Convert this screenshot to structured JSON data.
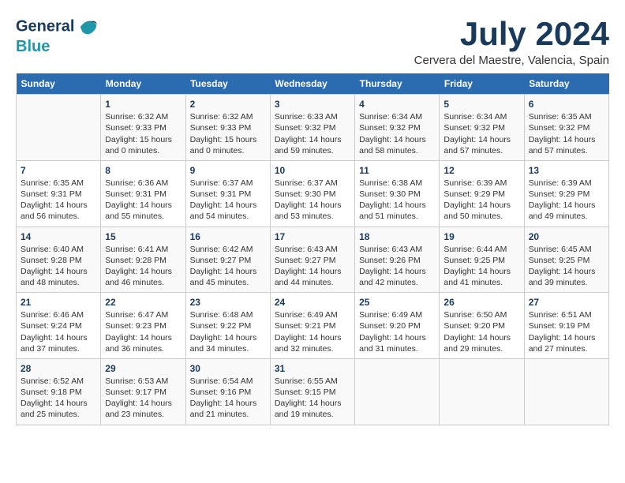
{
  "header": {
    "logo_line1": "General",
    "logo_line2": "Blue",
    "month_year": "July 2024",
    "location": "Cervera del Maestre, Valencia, Spain"
  },
  "days_of_week": [
    "Sunday",
    "Monday",
    "Tuesday",
    "Wednesday",
    "Thursday",
    "Friday",
    "Saturday"
  ],
  "weeks": [
    [
      {
        "day": "",
        "info": ""
      },
      {
        "day": "1",
        "info": "Sunrise: 6:32 AM\nSunset: 9:33 PM\nDaylight: 15 hours\nand 0 minutes."
      },
      {
        "day": "2",
        "info": "Sunrise: 6:32 AM\nSunset: 9:33 PM\nDaylight: 15 hours\nand 0 minutes."
      },
      {
        "day": "3",
        "info": "Sunrise: 6:33 AM\nSunset: 9:32 PM\nDaylight: 14 hours\nand 59 minutes."
      },
      {
        "day": "4",
        "info": "Sunrise: 6:34 AM\nSunset: 9:32 PM\nDaylight: 14 hours\nand 58 minutes."
      },
      {
        "day": "5",
        "info": "Sunrise: 6:34 AM\nSunset: 9:32 PM\nDaylight: 14 hours\nand 57 minutes."
      },
      {
        "day": "6",
        "info": "Sunrise: 6:35 AM\nSunset: 9:32 PM\nDaylight: 14 hours\nand 57 minutes."
      }
    ],
    [
      {
        "day": "7",
        "info": "Sunrise: 6:35 AM\nSunset: 9:31 PM\nDaylight: 14 hours\nand 56 minutes."
      },
      {
        "day": "8",
        "info": "Sunrise: 6:36 AM\nSunset: 9:31 PM\nDaylight: 14 hours\nand 55 minutes."
      },
      {
        "day": "9",
        "info": "Sunrise: 6:37 AM\nSunset: 9:31 PM\nDaylight: 14 hours\nand 54 minutes."
      },
      {
        "day": "10",
        "info": "Sunrise: 6:37 AM\nSunset: 9:30 PM\nDaylight: 14 hours\nand 53 minutes."
      },
      {
        "day": "11",
        "info": "Sunrise: 6:38 AM\nSunset: 9:30 PM\nDaylight: 14 hours\nand 51 minutes."
      },
      {
        "day": "12",
        "info": "Sunrise: 6:39 AM\nSunset: 9:29 PM\nDaylight: 14 hours\nand 50 minutes."
      },
      {
        "day": "13",
        "info": "Sunrise: 6:39 AM\nSunset: 9:29 PM\nDaylight: 14 hours\nand 49 minutes."
      }
    ],
    [
      {
        "day": "14",
        "info": "Sunrise: 6:40 AM\nSunset: 9:28 PM\nDaylight: 14 hours\nand 48 minutes."
      },
      {
        "day": "15",
        "info": "Sunrise: 6:41 AM\nSunset: 9:28 PM\nDaylight: 14 hours\nand 46 minutes."
      },
      {
        "day": "16",
        "info": "Sunrise: 6:42 AM\nSunset: 9:27 PM\nDaylight: 14 hours\nand 45 minutes."
      },
      {
        "day": "17",
        "info": "Sunrise: 6:43 AM\nSunset: 9:27 PM\nDaylight: 14 hours\nand 44 minutes."
      },
      {
        "day": "18",
        "info": "Sunrise: 6:43 AM\nSunset: 9:26 PM\nDaylight: 14 hours\nand 42 minutes."
      },
      {
        "day": "19",
        "info": "Sunrise: 6:44 AM\nSunset: 9:25 PM\nDaylight: 14 hours\nand 41 minutes."
      },
      {
        "day": "20",
        "info": "Sunrise: 6:45 AM\nSunset: 9:25 PM\nDaylight: 14 hours\nand 39 minutes."
      }
    ],
    [
      {
        "day": "21",
        "info": "Sunrise: 6:46 AM\nSunset: 9:24 PM\nDaylight: 14 hours\nand 37 minutes."
      },
      {
        "day": "22",
        "info": "Sunrise: 6:47 AM\nSunset: 9:23 PM\nDaylight: 14 hours\nand 36 minutes."
      },
      {
        "day": "23",
        "info": "Sunrise: 6:48 AM\nSunset: 9:22 PM\nDaylight: 14 hours\nand 34 minutes."
      },
      {
        "day": "24",
        "info": "Sunrise: 6:49 AM\nSunset: 9:21 PM\nDaylight: 14 hours\nand 32 minutes."
      },
      {
        "day": "25",
        "info": "Sunrise: 6:49 AM\nSunset: 9:20 PM\nDaylight: 14 hours\nand 31 minutes."
      },
      {
        "day": "26",
        "info": "Sunrise: 6:50 AM\nSunset: 9:20 PM\nDaylight: 14 hours\nand 29 minutes."
      },
      {
        "day": "27",
        "info": "Sunrise: 6:51 AM\nSunset: 9:19 PM\nDaylight: 14 hours\nand 27 minutes."
      }
    ],
    [
      {
        "day": "28",
        "info": "Sunrise: 6:52 AM\nSunset: 9:18 PM\nDaylight: 14 hours\nand 25 minutes."
      },
      {
        "day": "29",
        "info": "Sunrise: 6:53 AM\nSunset: 9:17 PM\nDaylight: 14 hours\nand 23 minutes."
      },
      {
        "day": "30",
        "info": "Sunrise: 6:54 AM\nSunset: 9:16 PM\nDaylight: 14 hours\nand 21 minutes."
      },
      {
        "day": "31",
        "info": "Sunrise: 6:55 AM\nSunset: 9:15 PM\nDaylight: 14 hours\nand 19 minutes."
      },
      {
        "day": "",
        "info": ""
      },
      {
        "day": "",
        "info": ""
      },
      {
        "day": "",
        "info": ""
      }
    ]
  ]
}
